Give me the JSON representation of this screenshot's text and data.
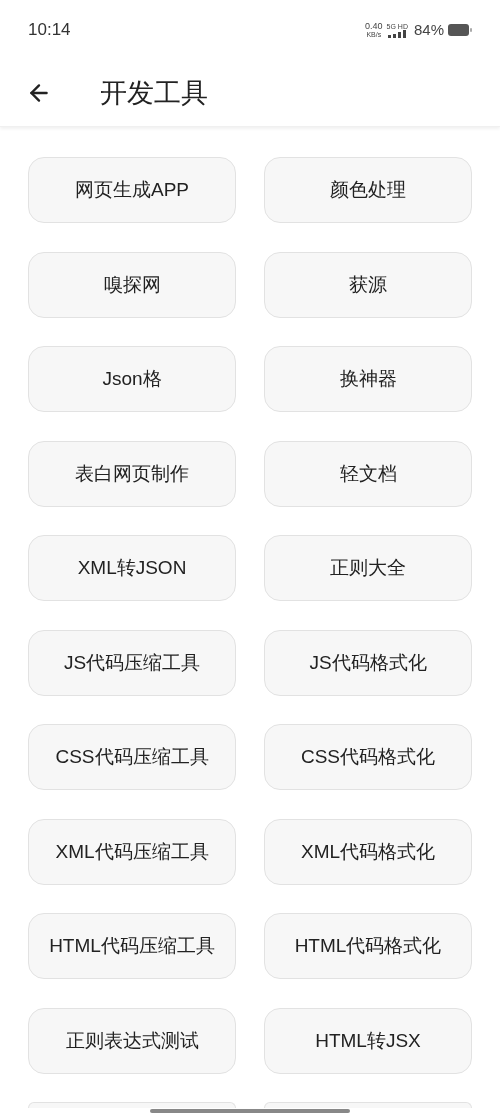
{
  "status_bar": {
    "time": "10:14",
    "net_speed_value": "0.40",
    "net_speed_unit": "KB/s",
    "network": "5G HD",
    "battery": "84%"
  },
  "header": {
    "title": "开发工具"
  },
  "tools": [
    {
      "kind": "tool",
      "label": "网页生成APP"
    },
    {
      "kind": "tool",
      "label": "颜色处理"
    },
    {
      "kind": "tool",
      "label": "嗅探网"
    },
    {
      "kind": "tool",
      "label": "获源"
    },
    {
      "kind": "tool",
      "label": "Json格"
    },
    {
      "kind": "tool",
      "label": "换神器"
    },
    {
      "kind": "tool",
      "label": "表白网页制作"
    },
    {
      "kind": "tool",
      "label": "轻文档"
    },
    {
      "kind": "tool",
      "label": "XML转JSON"
    },
    {
      "kind": "tool",
      "label": "正则大全"
    },
    {
      "kind": "tool",
      "label": "JS代码压缩工具"
    },
    {
      "kind": "tool",
      "label": "JS代码格式化"
    },
    {
      "kind": "tool",
      "label": "CSS代码压缩工具"
    },
    {
      "kind": "tool",
      "label": "CSS代码格式化"
    },
    {
      "kind": "tool",
      "label": "XML代码压缩工具"
    },
    {
      "kind": "tool",
      "label": "XML代码格式化"
    },
    {
      "kind": "tool",
      "label": "HTML代码压缩工具"
    },
    {
      "kind": "tool",
      "label": "HTML代码格式化"
    },
    {
      "kind": "tool",
      "label": "正则表达式测试"
    },
    {
      "kind": "tool",
      "label": "HTML转JSX"
    },
    {
      "kind": "blank"
    },
    {
      "kind": "blank"
    }
  ]
}
